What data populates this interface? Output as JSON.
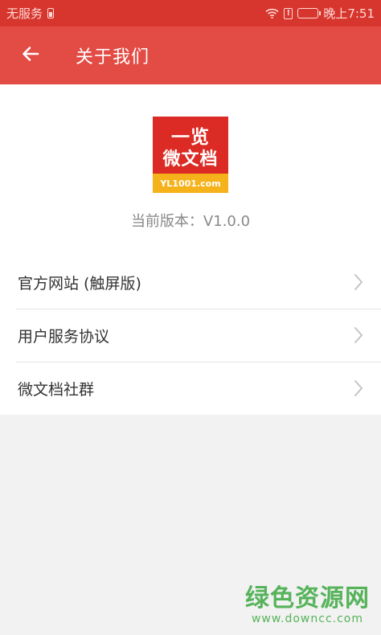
{
  "status_bar": {
    "carrier": "无服务",
    "time": "晚上7:51"
  },
  "header": {
    "title": "关于我们"
  },
  "about": {
    "logo_line1": "一览",
    "logo_line2": "微文档",
    "logo_url": "YL1001.com",
    "version": "当前版本：V1.0.0"
  },
  "menu": {
    "items": [
      {
        "label": "官方网站 (触屏版)"
      },
      {
        "label": "用户服务协议"
      },
      {
        "label": "微文档社群"
      }
    ]
  },
  "watermark": {
    "title": "绿色资源网",
    "url": "www.downcc.com"
  },
  "colors": {
    "status_bar": "#d6362e",
    "header": "#e34b45",
    "logo_red": "#dc2a24",
    "logo_yellow": "#f5b21b",
    "watermark_green": "#56b35a"
  }
}
